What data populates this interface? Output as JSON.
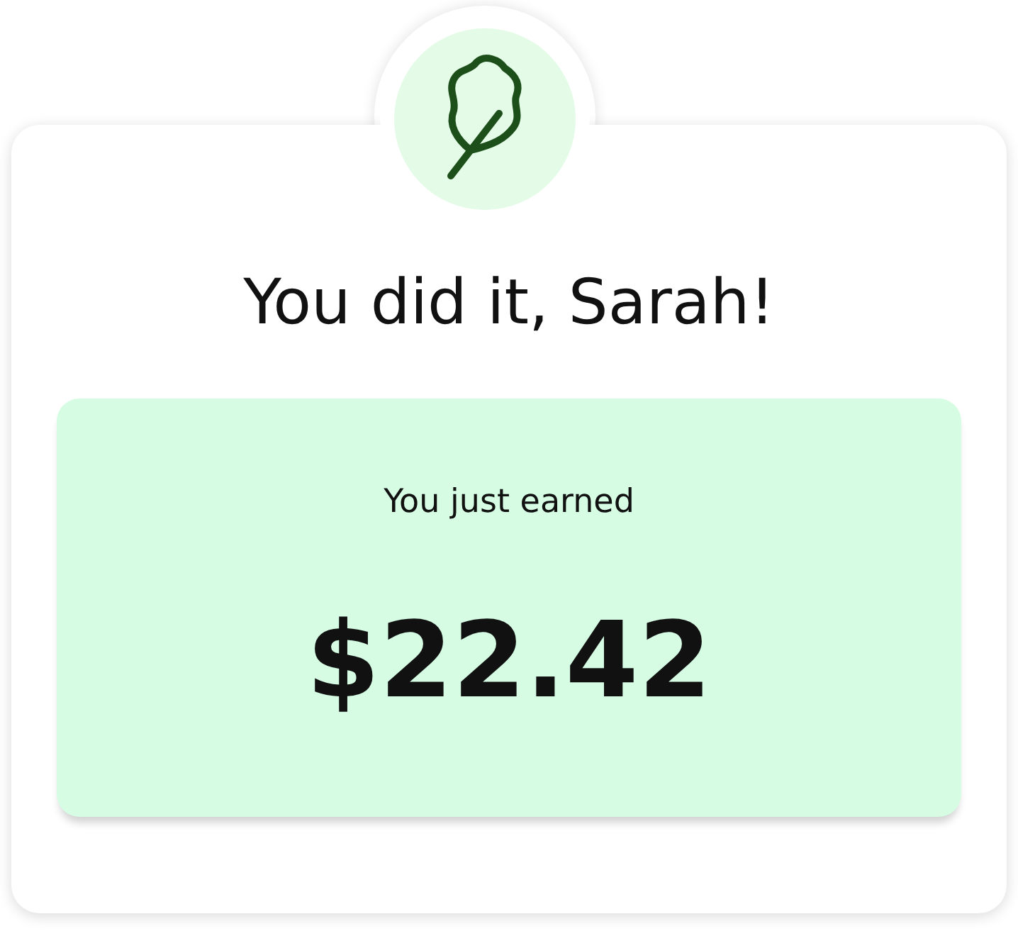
{
  "title": "You did it, Sarah!",
  "earnings": {
    "label": "You just earned",
    "amount": "$22.42"
  }
}
